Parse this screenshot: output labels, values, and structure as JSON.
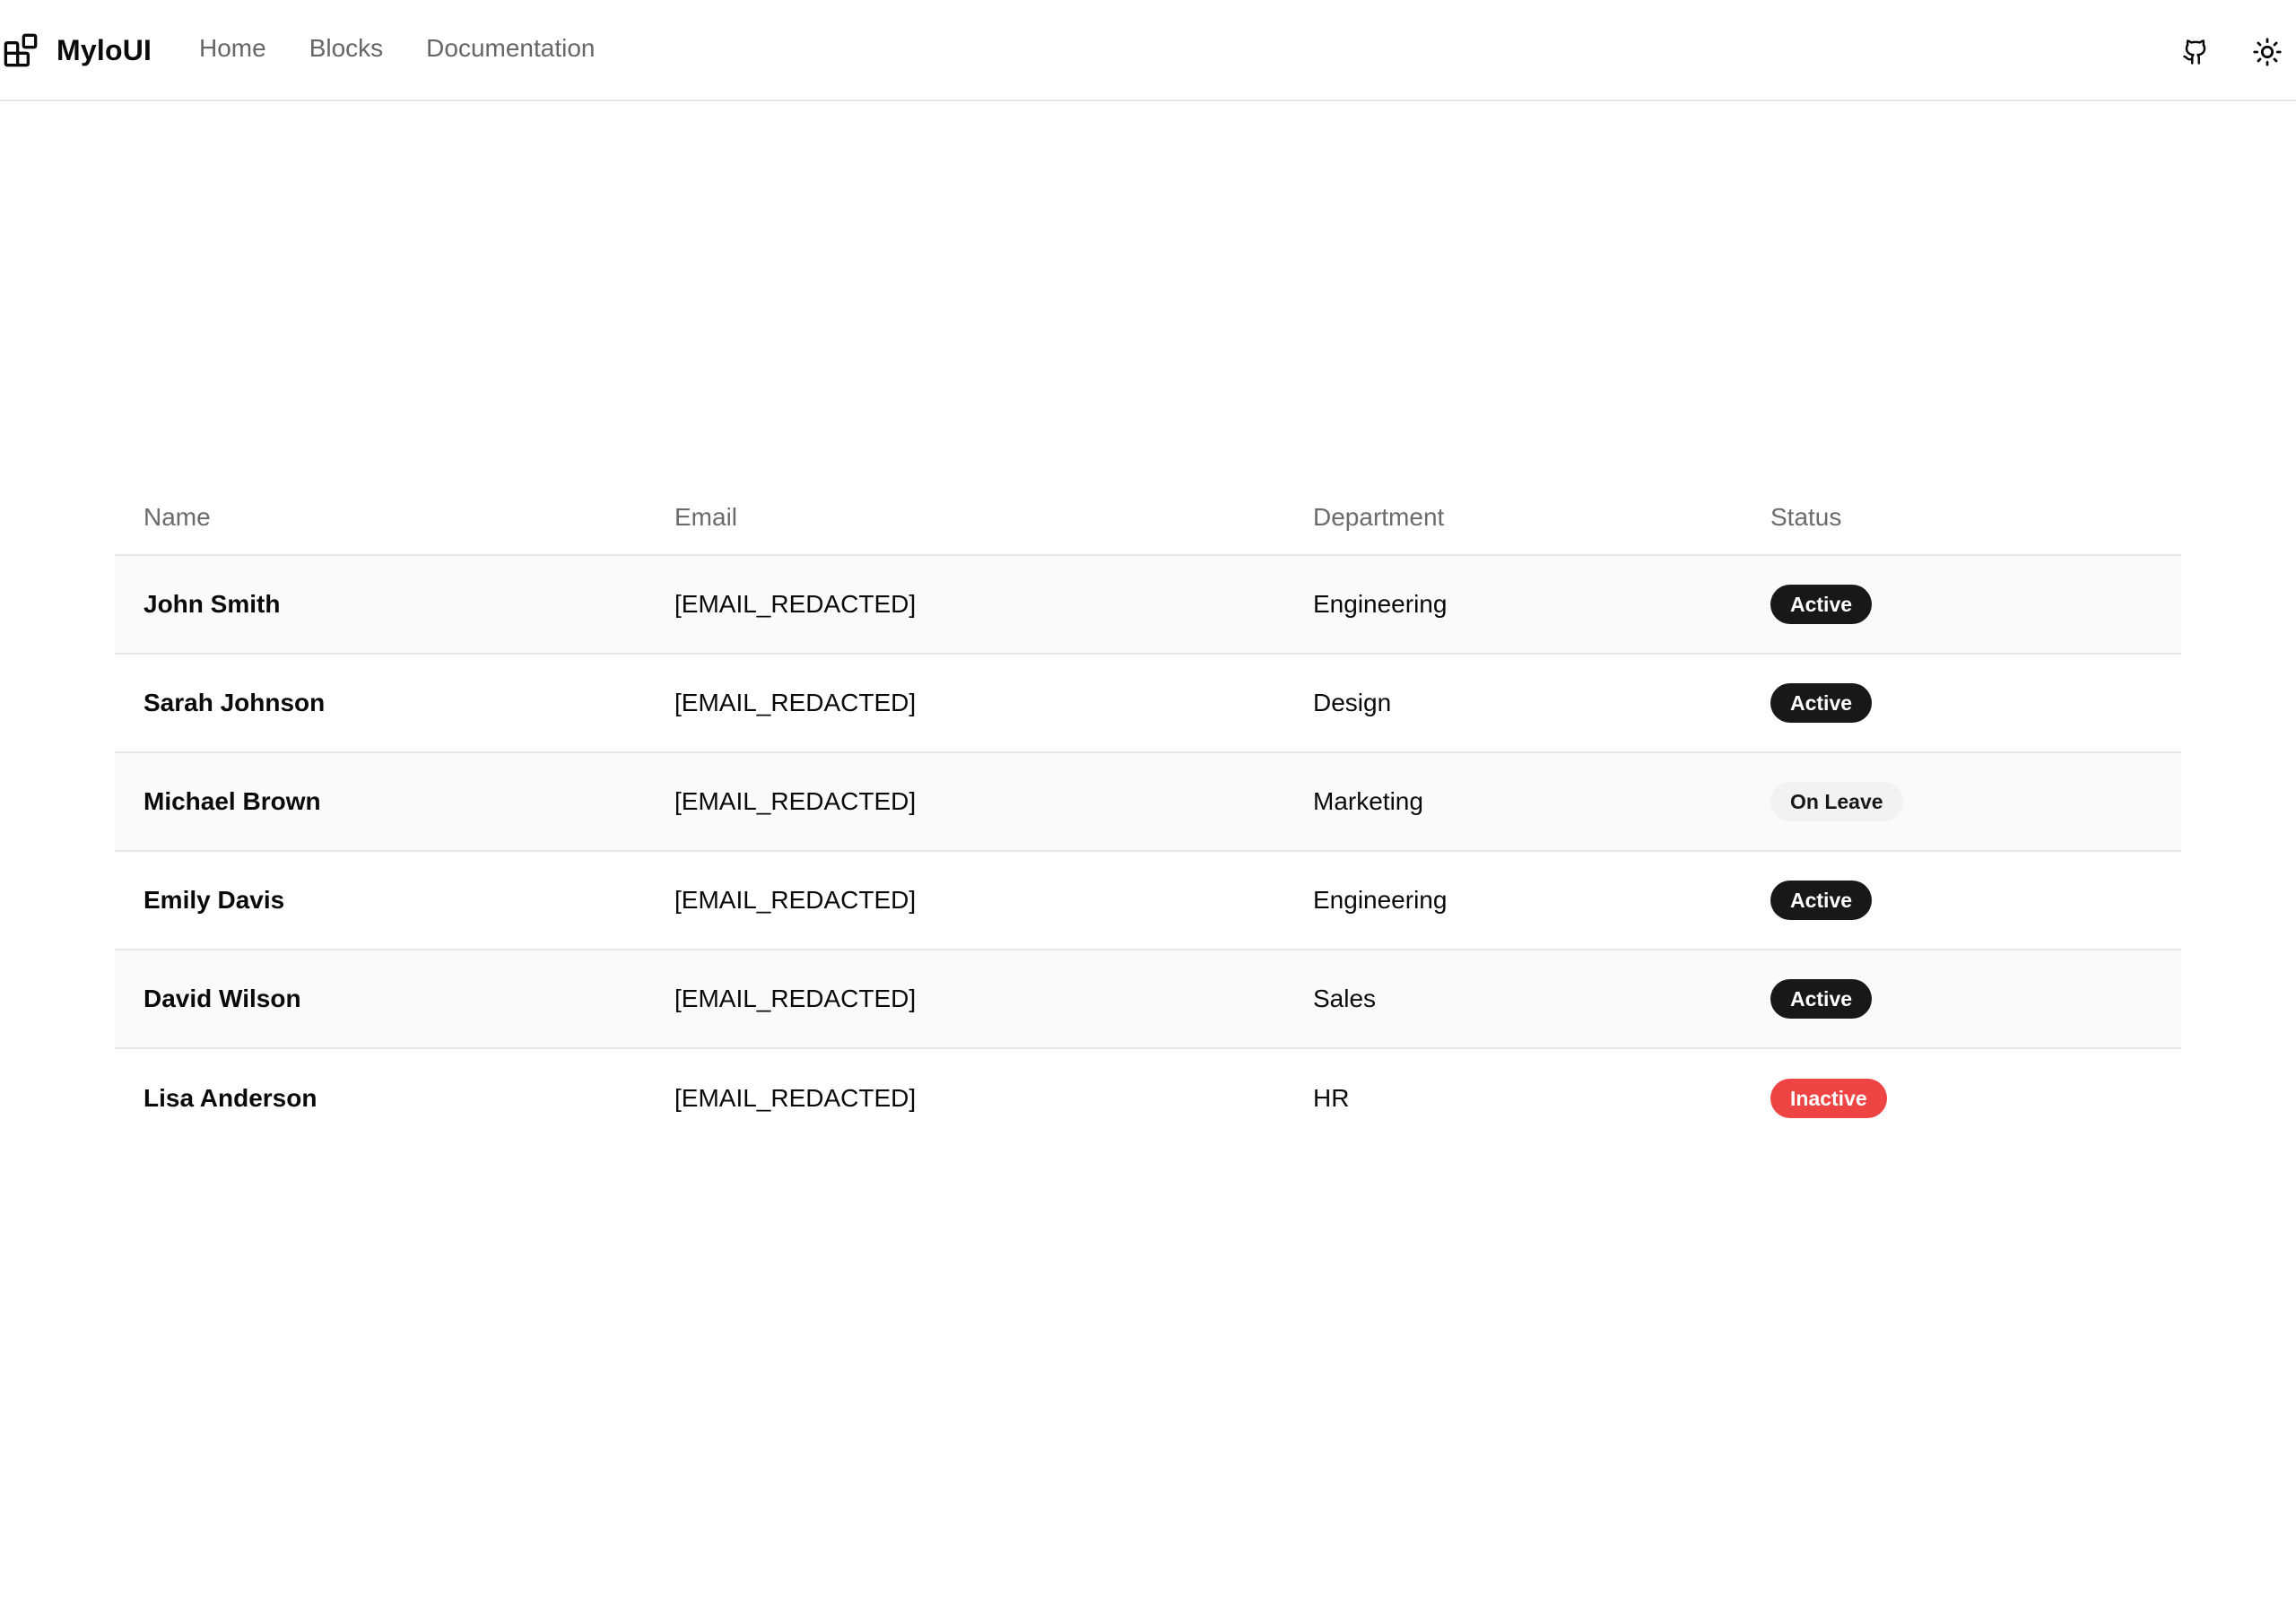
{
  "header": {
    "brand_name": "MyloUI",
    "brand_icon": "blocks-icon",
    "nav": [
      {
        "label": "Home"
      },
      {
        "label": "Blocks"
      },
      {
        "label": "Documentation"
      }
    ],
    "actions": [
      {
        "icon": "github-icon"
      },
      {
        "icon": "sun-icon"
      }
    ]
  },
  "table": {
    "columns": [
      "Name",
      "Email",
      "Department",
      "Status"
    ],
    "rows": [
      {
        "name": "John Smith",
        "email": "[EMAIL_REDACTED]",
        "department": "Engineering",
        "status": "Active"
      },
      {
        "name": "Sarah Johnson",
        "email": "[EMAIL_REDACTED]",
        "department": "Design",
        "status": "Active"
      },
      {
        "name": "Michael Brown",
        "email": "[EMAIL_REDACTED]",
        "department": "Marketing",
        "status": "On Leave"
      },
      {
        "name": "Emily Davis",
        "email": "[EMAIL_REDACTED]",
        "department": "Engineering",
        "status": "Active"
      },
      {
        "name": "David Wilson",
        "email": "[EMAIL_REDACTED]",
        "department": "Sales",
        "status": "Active"
      },
      {
        "name": "Lisa Anderson",
        "email": "[EMAIL_REDACTED]",
        "department": "HR",
        "status": "Inactive"
      }
    ]
  },
  "colors": {
    "active_badge": "#18181b",
    "on_leave_badge": "#f2f2f2",
    "inactive_badge": "#ef4444"
  }
}
